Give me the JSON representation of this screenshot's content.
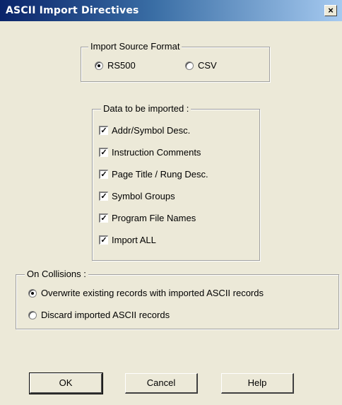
{
  "window": {
    "title": "ASCII Import Directives",
    "close_label": "×"
  },
  "import_source_format": {
    "legend": "Import Source Format",
    "options": [
      {
        "label": "RS500",
        "selected": true
      },
      {
        "label": "CSV",
        "selected": false
      }
    ]
  },
  "data_to_import": {
    "legend": "Data to be imported  :",
    "items": [
      {
        "label": "Addr/Symbol Desc.",
        "checked": true
      },
      {
        "label": "Instruction Comments",
        "checked": true
      },
      {
        "label": "Page Title / Rung Desc.",
        "checked": true
      },
      {
        "label": "Symbol Groups",
        "checked": true
      },
      {
        "label": "Program File Names",
        "checked": true
      },
      {
        "label": "Import ALL",
        "checked": true
      }
    ],
    "check_glyph": "✓"
  },
  "on_collisions": {
    "legend": "On Collisions :",
    "options": [
      {
        "label": "Overwrite existing records with imported ASCII records",
        "selected": true
      },
      {
        "label": "Discard imported ASCII records",
        "selected": false
      }
    ]
  },
  "buttons": {
    "ok": "OK",
    "cancel": "Cancel",
    "help": "Help"
  }
}
